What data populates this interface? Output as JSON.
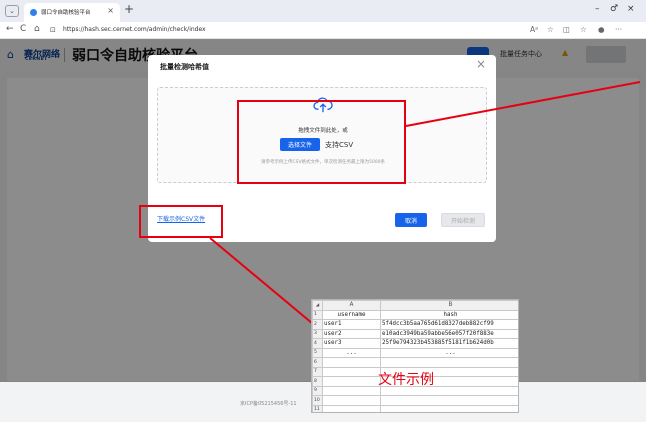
{
  "browser": {
    "tab_menu_glyph": "⌄",
    "tab_title": "弱口令自助核验平台",
    "tab_close_glyph": "×",
    "new_tab_glyph": "+",
    "url": "https://hash.sec.cernet.com/admin/check/index",
    "window_controls": [
      "–",
      "♂",
      "×"
    ],
    "nav_glyphs": [
      "←",
      "C",
      "⌂",
      "⊡"
    ],
    "toolbar_glyphs": [
      "Aᵃ",
      "☆",
      "◫",
      "☆",
      "●",
      "···"
    ]
  },
  "header": {
    "logo_glyph": "⌂",
    "logo_cn": "赛尔网络",
    "logo_en": "CERNET",
    "title": "弱口令自助核验平台",
    "batch_center": "批量任务中心",
    "bell_glyph": "▲"
  },
  "footer": {
    "text": "京ICP备05215456号-11"
  },
  "modal": {
    "title": "批量检测哈希值",
    "close_glyph": "×",
    "drag_text": "拖拽文件到此处，或",
    "choose_file": "选择文件",
    "support_csv": "支持CSV",
    "hint": "请参考示例上传CSV格式文件，单次检测任务最上限为5000条",
    "download_sample": "下载示例CSV文件",
    "cancel": "取消",
    "start": "开始检测"
  },
  "csv_sample": {
    "corner": "◢",
    "col_headers": [
      "A",
      "B"
    ],
    "rows": [
      {
        "n": "1",
        "a": "username",
        "b": "hash"
      },
      {
        "n": "2",
        "a": "user1",
        "b": "5f4dcc3b5aa765d61d8327deb882cf99"
      },
      {
        "n": "3",
        "a": "user2",
        "b": "e10adc3949ba59abbe56e057f20f883e"
      },
      {
        "n": "4",
        "a": "user3",
        "b": "25f9e794323b453885f5181f1b624d0b"
      },
      {
        "n": "5",
        "a": "...",
        "b": "..."
      },
      {
        "n": "6",
        "a": "",
        "b": ""
      },
      {
        "n": "7",
        "a": "",
        "b": ""
      },
      {
        "n": "8",
        "a": "",
        "b": ""
      },
      {
        "n": "9",
        "a": "",
        "b": ""
      },
      {
        "n": "10",
        "a": "",
        "b": ""
      },
      {
        "n": "11",
        "a": "",
        "b": ""
      }
    ],
    "label": "文件示例"
  },
  "colors": {
    "brand_blue": "#1764ea",
    "annotation_red": "#e60012"
  }
}
